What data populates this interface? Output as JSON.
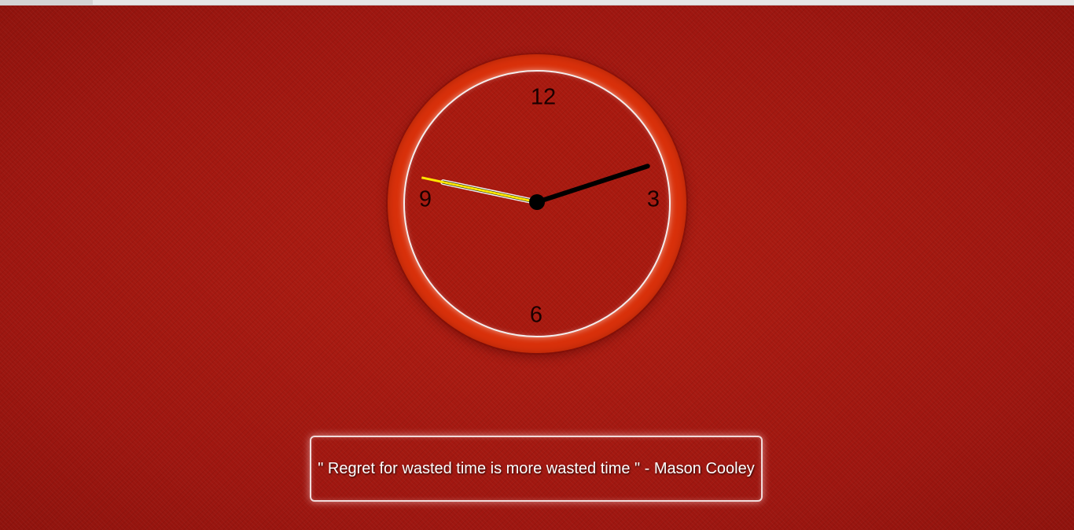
{
  "clock": {
    "numerals": {
      "twelve": "12",
      "three": "3",
      "six": "6",
      "nine": "9"
    },
    "time": {
      "hour_hand_position_hours": 2.4,
      "minute_hand_position_minutes": 47,
      "second_hand_position_seconds": 47
    },
    "colors": {
      "ring": "#d9310b",
      "face_border": "#f4eded",
      "hands": "#000000",
      "second_hand": "#ffe600"
    }
  },
  "quote": {
    "text": "\" Regret for wasted time is more wasted time \" - Mason Cooley"
  },
  "colors": {
    "background": "#a3170f"
  }
}
